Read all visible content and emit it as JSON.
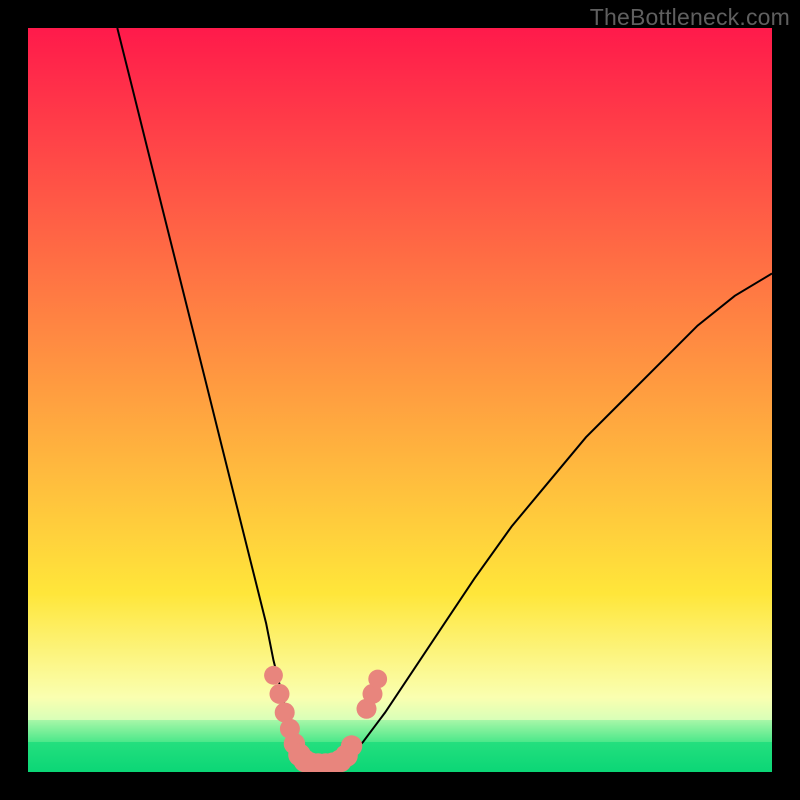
{
  "watermark": "TheBottleneck.com",
  "chart_data": {
    "type": "line",
    "title": "",
    "xlabel": "",
    "ylabel": "",
    "xlim": [
      0,
      100
    ],
    "ylim": [
      0,
      100
    ],
    "series": [
      {
        "name": "curve-left",
        "x": [
          12,
          14,
          16,
          18,
          20,
          22,
          24,
          26,
          28,
          30,
          32,
          33,
          34,
          35,
          36,
          37
        ],
        "y": [
          100,
          92,
          84,
          76,
          68,
          60,
          52,
          44,
          36,
          28,
          20,
          15,
          11,
          7,
          4,
          2
        ]
      },
      {
        "name": "curve-right",
        "x": [
          43,
          45,
          48,
          52,
          56,
          60,
          65,
          70,
          75,
          80,
          85,
          90,
          95,
          100
        ],
        "y": [
          2,
          4,
          8,
          14,
          20,
          26,
          33,
          39,
          45,
          50,
          55,
          60,
          64,
          67
        ]
      }
    ],
    "markers": {
      "name": "highlight-points",
      "color": "#e8857d",
      "points": [
        {
          "x": 33.0,
          "y": 13.0,
          "r": 1.4
        },
        {
          "x": 33.8,
          "y": 10.5,
          "r": 1.5
        },
        {
          "x": 34.5,
          "y": 8.0,
          "r": 1.5
        },
        {
          "x": 35.2,
          "y": 5.8,
          "r": 1.5
        },
        {
          "x": 35.8,
          "y": 3.8,
          "r": 1.6
        },
        {
          "x": 36.5,
          "y": 2.3,
          "r": 1.7
        },
        {
          "x": 37.2,
          "y": 1.5,
          "r": 1.7
        },
        {
          "x": 38.0,
          "y": 1.1,
          "r": 1.7
        },
        {
          "x": 39.0,
          "y": 1.0,
          "r": 1.7
        },
        {
          "x": 40.0,
          "y": 1.0,
          "r": 1.7
        },
        {
          "x": 41.0,
          "y": 1.1,
          "r": 1.7
        },
        {
          "x": 42.0,
          "y": 1.5,
          "r": 1.7
        },
        {
          "x": 42.8,
          "y": 2.2,
          "r": 1.7
        },
        {
          "x": 43.5,
          "y": 3.5,
          "r": 1.6
        },
        {
          "x": 45.5,
          "y": 8.5,
          "r": 1.5
        },
        {
          "x": 46.3,
          "y": 10.5,
          "r": 1.5
        },
        {
          "x": 47.0,
          "y": 12.5,
          "r": 1.4
        }
      ]
    },
    "background_bands": [
      {
        "from_y": 100,
        "to_y": 24,
        "top_color": "#ff1a4b",
        "bottom_color": "#ffe63a"
      },
      {
        "from_y": 24,
        "to_y": 10,
        "top_color": "#ffe63a",
        "bottom_color": "#faffb0"
      },
      {
        "from_y": 10,
        "to_y": 7,
        "top_color": "#faffb0",
        "bottom_color": "#d8ffb8"
      },
      {
        "from_y": 7,
        "to_y": 4,
        "top_color": "#a8f7a8",
        "bottom_color": "#4be88a"
      },
      {
        "from_y": 4,
        "to_y": 0,
        "top_color": "#24df7e",
        "bottom_color": "#0bd676"
      }
    ]
  }
}
